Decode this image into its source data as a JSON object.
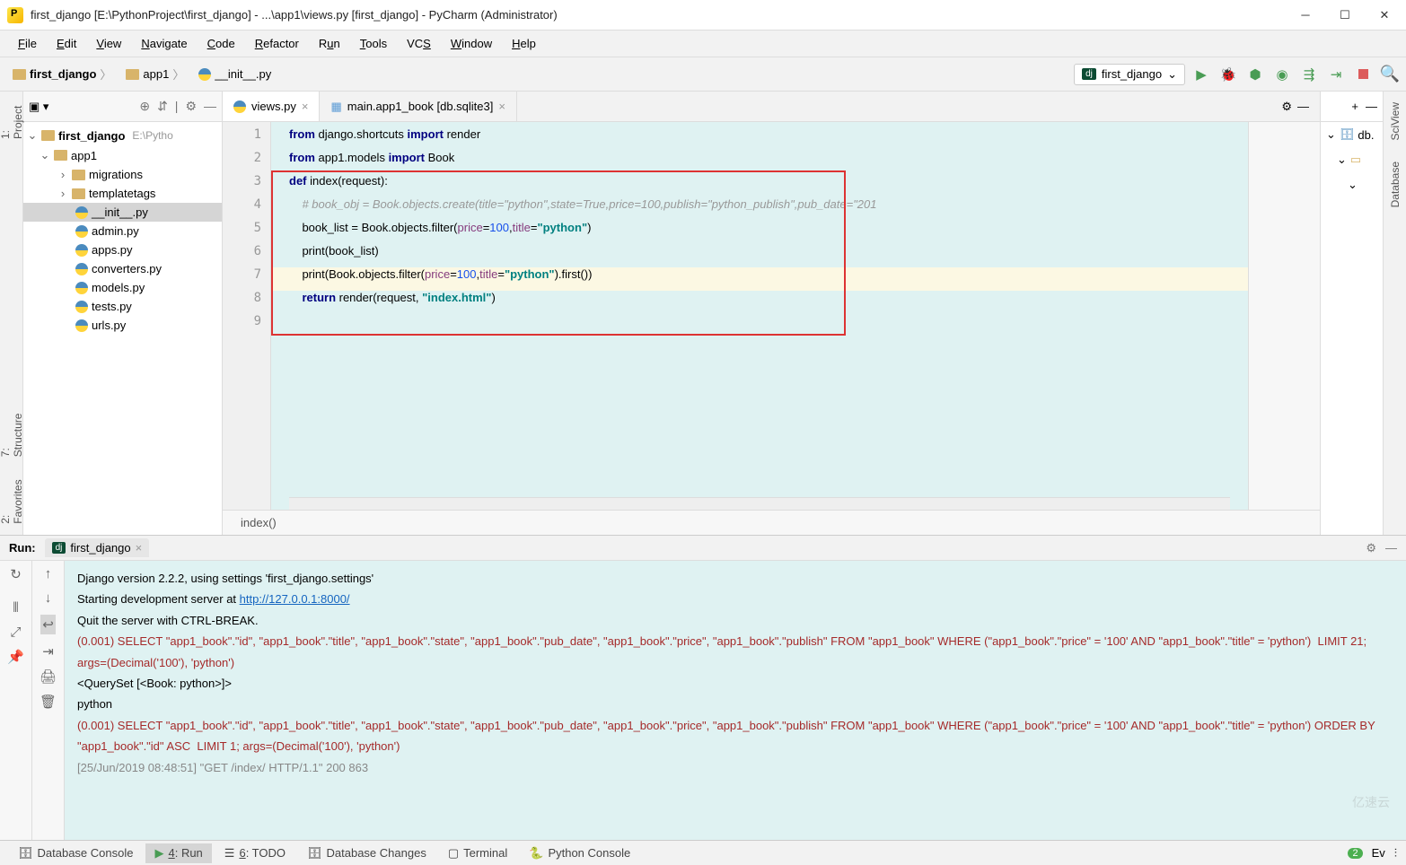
{
  "window": {
    "title": "first_django [E:\\PythonProject\\first_django] - ...\\app1\\views.py [first_django] - PyCharm (Administrator)"
  },
  "menu": [
    "File",
    "Edit",
    "View",
    "Navigate",
    "Code",
    "Refactor",
    "Run",
    "Tools",
    "VCS",
    "Window",
    "Help"
  ],
  "breadcrumbs": [
    {
      "label": "first_django",
      "icon": "folder"
    },
    {
      "label": "app1",
      "icon": "folder"
    },
    {
      "label": "__init__.py",
      "icon": "py"
    }
  ],
  "run_config": {
    "name": "first_django"
  },
  "project_tree": {
    "root": {
      "label": "first_django",
      "meta": "E:\\Pytho"
    },
    "app1": {
      "label": "app1"
    },
    "folders": [
      {
        "label": "migrations"
      },
      {
        "label": "templatetags"
      }
    ],
    "files": [
      {
        "label": "__init__.py",
        "selected": true
      },
      {
        "label": "admin.py"
      },
      {
        "label": "apps.py"
      },
      {
        "label": "converters.py"
      },
      {
        "label": "models.py"
      },
      {
        "label": "tests.py"
      },
      {
        "label": "urls.py"
      }
    ]
  },
  "editor_tabs": [
    {
      "label": "views.py",
      "icon": "py",
      "active": true
    },
    {
      "label": "main.app1_book [db.sqlite3]",
      "icon": "table",
      "active": false
    }
  ],
  "code": {
    "lines": [
      "1",
      "2",
      "3",
      "4",
      "5",
      "6",
      "7",
      "8",
      "9"
    ],
    "l1_pre": "from",
    "l1_mod": " django.shortcuts ",
    "l1_imp": "import",
    "l1_tail": " render",
    "l2_pre": "from",
    "l2_mod": " app1.models ",
    "l2_imp": "import",
    "l2_tail": " Book",
    "l3_def": "def ",
    "l3_name": "index",
    "l3_params": "(request):",
    "l4_comment": "    # book_obj = Book.objects.create(title=\"python\",state=True,price=100,publish=\"python_publish\",pub_date=\"201",
    "l5_a": "    book_list = Book.objects.filter(",
    "l5_p1": "price",
    "l5_eq1": "=",
    "l5_n1": "100",
    "l5_c": ",",
    "l5_p2": "title",
    "l5_eq2": "=",
    "l5_s": "\"python\"",
    "l5_z": ")",
    "l6": "    print(book_list)",
    "l7_a": "    print(Book.objects.filter(",
    "l7_p1": "price",
    "l7_eq1": "=",
    "l7_n1": "100",
    "l7_c": ",",
    "l7_p2": "title",
    "l7_eq2": "=",
    "l7_s": "\"python\"",
    "l7_z": ").first())",
    "l8_a": "    ",
    "l8_ret": "return",
    "l8_b": " render(request, ",
    "l8_s": "\"index.html\"",
    "l8_z": ")"
  },
  "editor_breadcrumb": "index()",
  "left_rail": {
    "project": "1: Project",
    "structure": "7: Structure",
    "favorites": "2: Favorites"
  },
  "right_rail": {
    "sciview": "SciView",
    "database": "Database",
    "db": "db."
  },
  "run_panel": {
    "title": "Run:",
    "tab": "first_django",
    "lines": [
      {
        "type": "plain",
        "text": "Django version 2.2.2, using settings 'first_django.settings'"
      },
      {
        "type": "link_line",
        "pre": "Starting development server at ",
        "link": "http://127.0.0.1:8000/"
      },
      {
        "type": "plain",
        "text": "Quit the server with CTRL-BREAK."
      },
      {
        "type": "sql",
        "text": "(0.001) SELECT \"app1_book\".\"id\", \"app1_book\".\"title\", \"app1_book\".\"state\", \"app1_book\".\"pub_date\", \"app1_book\".\"price\", \"app1_book\".\"publish\" FROM \"app1_book\" WHERE (\"app1_book\".\"price\" = '100' AND \"app1_book\".\"title\" = 'python')  LIMIT 21; args=(Decimal('100'), 'python')"
      },
      {
        "type": "plain",
        "text": "<QuerySet [<Book: python>]>"
      },
      {
        "type": "plain",
        "text": "python"
      },
      {
        "type": "sql",
        "text": "(0.001) SELECT \"app1_book\".\"id\", \"app1_book\".\"title\", \"app1_book\".\"state\", \"app1_book\".\"pub_date\", \"app1_book\".\"price\", \"app1_book\".\"publish\" FROM \"app1_book\" WHERE (\"app1_book\".\"price\" = '100' AND \"app1_book\".\"title\" = 'python') ORDER BY \"app1_book\".\"id\" ASC  LIMIT 1; args=(Decimal('100'), 'python')"
      },
      {
        "type": "log",
        "text": "[25/Jun/2019 08:48:51] \"GET /index/ HTTP/1.1\" 200 863"
      }
    ]
  },
  "statusbar": {
    "items": [
      {
        "label": "Database Console",
        "icon": "🗄"
      },
      {
        "label": "4: Run",
        "icon": "▶",
        "active": true,
        "underline": "4"
      },
      {
        "label": "6: TODO",
        "icon": "☰",
        "underline": "6"
      },
      {
        "label": "Database Changes",
        "icon": "🗄"
      },
      {
        "label": "Terminal",
        "icon": "▢"
      },
      {
        "label": "Python Console",
        "icon": "🐍"
      }
    ],
    "events_count": "2",
    "events_label": "Ev"
  },
  "watermark": "亿速云"
}
